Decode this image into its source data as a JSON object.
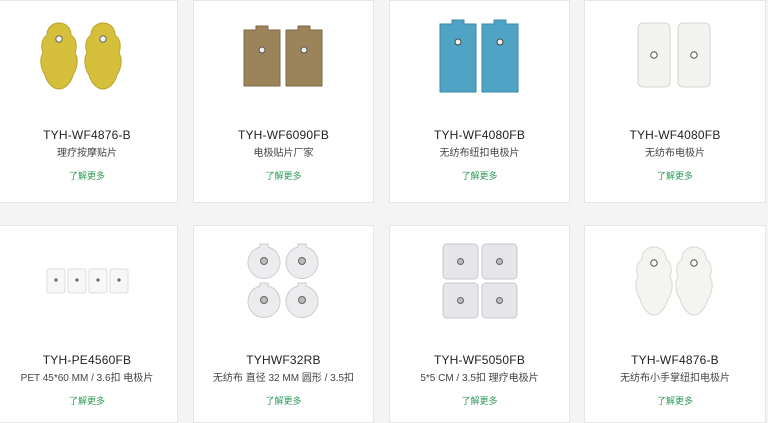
{
  "products": [
    {
      "code": "TYH-WF4876-B",
      "desc": "理疗按摩贴片",
      "more": "了解更多"
    },
    {
      "code": "TYH-WF6090FB",
      "desc": "电极贴片厂家",
      "more": "了解更多"
    },
    {
      "code": "TYH-WF4080FB",
      "desc": "无纺布纽扣电极片",
      "more": "了解更多"
    },
    {
      "code": "TYH-WF4080FB",
      "desc": "无纺布电极片",
      "more": "了解更多"
    },
    {
      "code": "TYH-PE4560FB",
      "desc": "PET 45*60 MM / 3.6扣 电极片",
      "more": "了解更多"
    },
    {
      "code": "TYHWF32RB",
      "desc": "无纺布 直径 32 MM 圆形 / 3.5扣",
      "more": "了解更多"
    },
    {
      "code": "TYH-WF5050FB",
      "desc": "5*5 CM / 3.5扣 理疗电极片",
      "more": "了解更多"
    },
    {
      "code": "TYH-WF4876-B",
      "desc": "无纺布小手掌纽扣电极片",
      "more": "了解更多"
    }
  ]
}
